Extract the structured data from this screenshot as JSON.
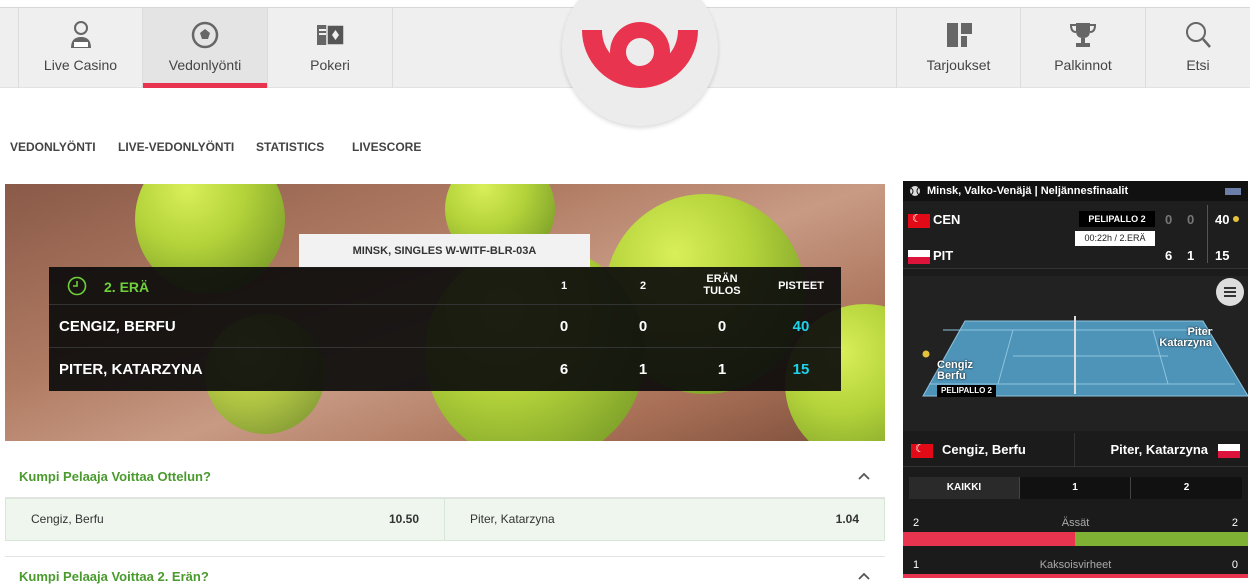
{
  "top_nav": {
    "items": [
      {
        "label": "Live Casino",
        "icon": "dealer-icon"
      },
      {
        "label": "Vedonlyönti",
        "icon": "soccer-ball-icon",
        "active": true
      },
      {
        "label": "Pokeri",
        "icon": "cards-icon"
      },
      {
        "label": "Tarjoukset",
        "icon": "grid-icon"
      },
      {
        "label": "Palkinnot",
        "icon": "trophy-icon"
      },
      {
        "label": "Etsi",
        "icon": "search-icon"
      }
    ],
    "logo": "brand-logo"
  },
  "sub_nav": [
    "VEDONLYÖNTI",
    "LIVE-VEDONLYÖNTI",
    "STATISTICS",
    "LIVESCORE"
  ],
  "scoreboard": {
    "tournament": "MINSK, SINGLES W-WITF-BLR-03A",
    "set_label": "2. ERÄ",
    "headers": [
      "1",
      "2",
      "ERÄN TULOS",
      "PISTEET"
    ],
    "players": [
      {
        "name": "CENGIZ, BERFU",
        "set1": "0",
        "set2": "0",
        "games": "0",
        "points": "40"
      },
      {
        "name": "PITER, KATARZYNA",
        "set1": "6",
        "set2": "1",
        "games": "1",
        "points": "15"
      }
    ]
  },
  "markets": [
    {
      "title": "Kumpi Pelaaja Voittaa Ottelun?",
      "outcomes": [
        {
          "name": "Cengiz, Berfu",
          "odds": "10.50"
        },
        {
          "name": "Piter, Katarzyna",
          "odds": "1.04"
        }
      ]
    },
    {
      "title": "Kumpi Pelaaja Voittaa 2. Erän?"
    }
  ],
  "widget": {
    "header": "Minsk, Valko-Venäjä | Neljännesfinaalit",
    "serve_badge": "PELIPALLO",
    "serve_badge_num": "2",
    "time": "00:22h",
    "set_info": "2.ERÄ",
    "players": [
      {
        "code": "CEN",
        "s1": "0",
        "s2": "0",
        "pts": "40"
      },
      {
        "code": "PIT",
        "s1": "6",
        "s2": "1",
        "pts": "15"
      }
    ],
    "court": {
      "left_player_first": "Cengiz",
      "left_player_second": "Berfu",
      "right_player_first": "Piter",
      "right_player_second": "Katarzyna",
      "serve_label": "PELIPALLO 2"
    },
    "names": {
      "left": "Cengiz, Berfu",
      "right": "Piter, Katarzyna"
    },
    "tabs": [
      "KAIKKI",
      "1",
      "2"
    ],
    "stats": [
      {
        "label": "Ässät",
        "left": "2",
        "right": "2"
      },
      {
        "label": "Kaksoisvirheet",
        "left": "1",
        "right": "0"
      }
    ],
    "colors": {
      "left": "#e8344e",
      "right": "#7fb135"
    }
  }
}
